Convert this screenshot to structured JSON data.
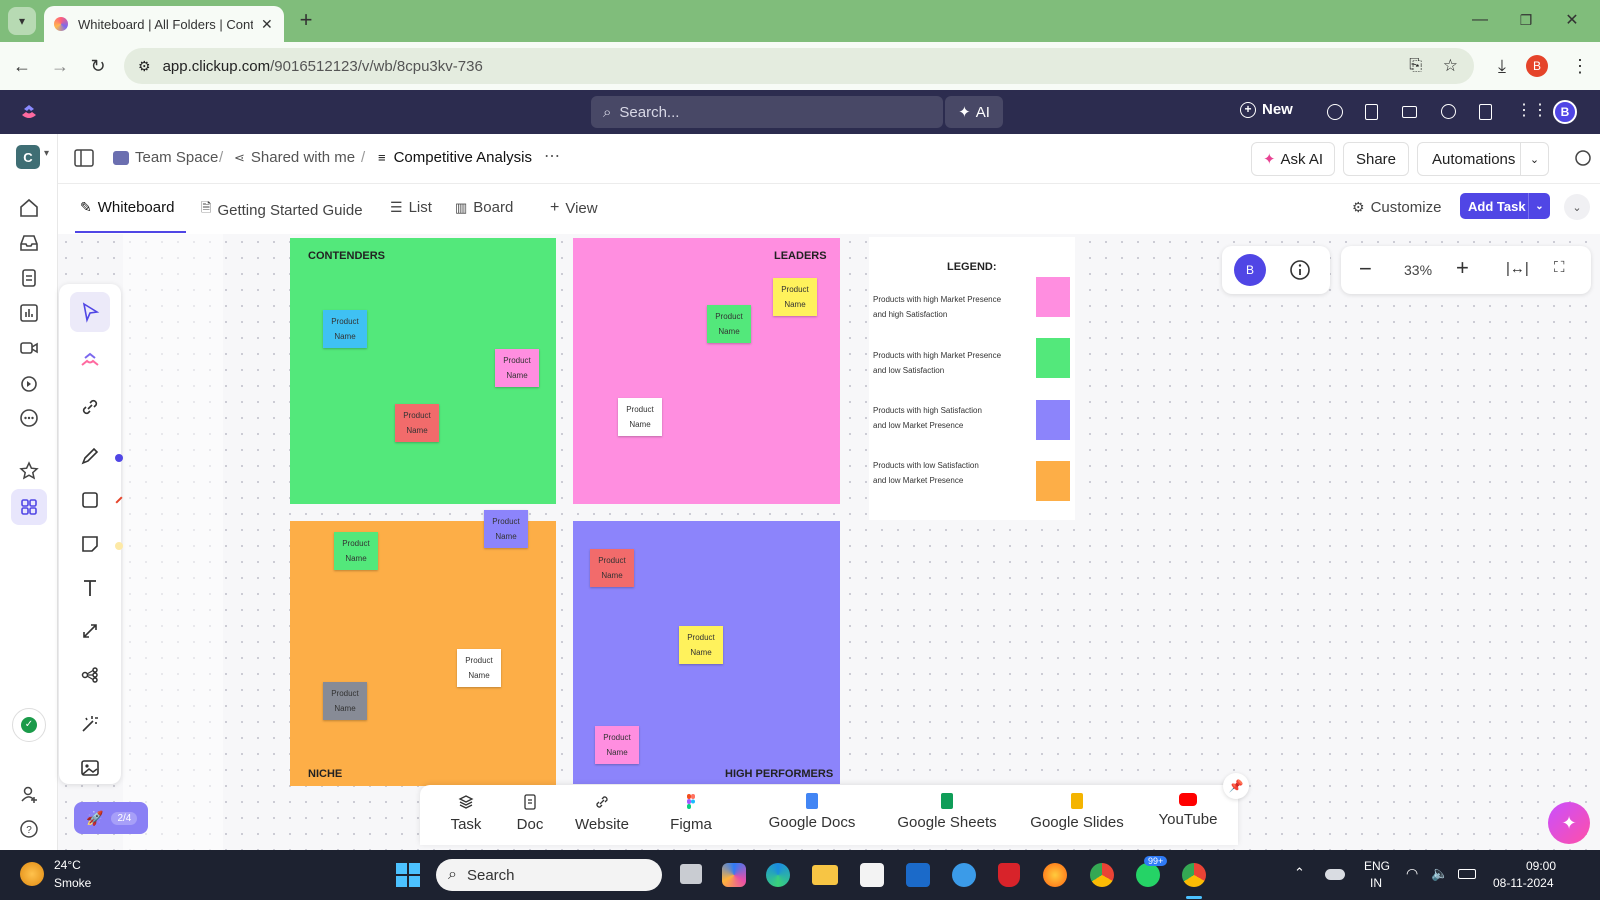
{
  "browser": {
    "tab_title": "Whiteboard | All Folders | Conte",
    "url_host": "app.clickup.com",
    "url_path": "/9016512123/v/wb/8cpu3kv-736",
    "profile_initial": "B"
  },
  "app_header": {
    "search_placeholder": "Search...",
    "ai_label": "AI",
    "new_label": "New",
    "avatar_initial": "B"
  },
  "workspace": {
    "initial": "C"
  },
  "breadcrumb": {
    "space": "Team Space",
    "shared": "Shared with me",
    "page": "Competitive Analysis",
    "sep": "/"
  },
  "header_actions": {
    "ask_ai": "Ask AI",
    "share": "Share",
    "automations": "Automations"
  },
  "view_tabs": {
    "whiteboard": "Whiteboard",
    "getting_started": "Getting Started Guide",
    "list": "List",
    "board": "Board",
    "add_view": "View",
    "customize": "Customize",
    "add_task": "Add Task"
  },
  "quadrants": {
    "contenders": "CONTENDERS",
    "leaders": "LEADERS",
    "niche": "NICHE",
    "high_performers": "HIGH PERFORMERS"
  },
  "note_text": "Product Name",
  "legend": {
    "title": "LEGEND:",
    "items": [
      {
        "line1": "Products with high Market Presence",
        "line2": "and high Satisfaction",
        "color": "#ff8ee0"
      },
      {
        "line1": "Products with high Market Presence",
        "line2": "and low Satisfaction",
        "color": "#53e87b"
      },
      {
        "line1": "Products with high Satisfaction",
        "line2": "and low Market Presence",
        "color": "#8c84fb"
      },
      {
        "line1": "Products with low Satisfaction",
        "line2": "and low Market Presence",
        "color": "#fdae47"
      }
    ]
  },
  "colors": {
    "green": "#53e87b",
    "pink": "#ff8ee0",
    "orange": "#fdae47",
    "purple": "#8c84fb",
    "blue_note": "#3fc1f3",
    "red_note": "#f26b6b",
    "yellow_note": "#fff25c",
    "grey_note": "#878b96",
    "accent": "#5046e5"
  },
  "zoom": {
    "user_initial": "B",
    "level": "33%"
  },
  "progress_badge": "2/4",
  "dock": {
    "task": "Task",
    "doc": "Doc",
    "website": "Website",
    "figma": "Figma",
    "google_docs": "Google Docs",
    "google_sheets": "Google Sheets",
    "google_slides": "Google Slides",
    "youtube": "YouTube"
  },
  "taskbar": {
    "temp": "24°C",
    "weather": "Smoke",
    "search": "Search",
    "lang1": "ENG",
    "lang2": "IN",
    "time": "09:00",
    "date": "08-11-2024",
    "badge": "99+"
  }
}
